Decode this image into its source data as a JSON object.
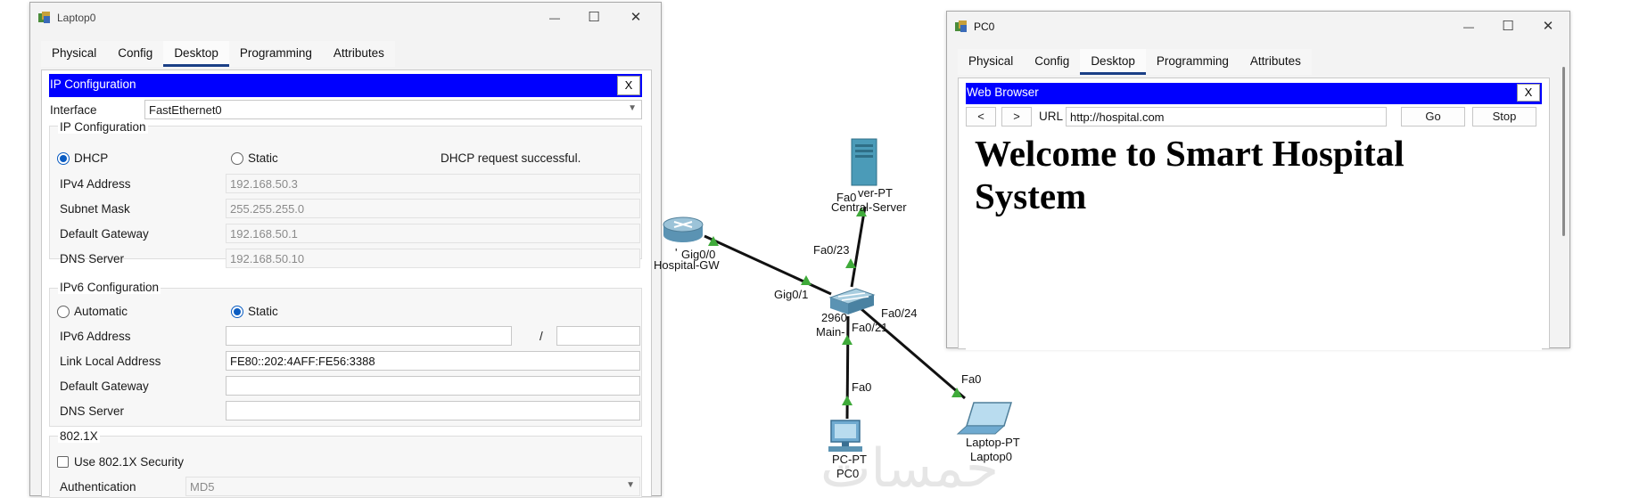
{
  "laptop_window": {
    "title": "Laptop0",
    "controls": {
      "minimize": "—",
      "maximize": "☐",
      "close": "✕"
    },
    "tabs": [
      "Physical",
      "Config",
      "Desktop",
      "Programming",
      "Attributes"
    ],
    "active_tab": "Desktop",
    "app_title": "IP Configuration",
    "close_label": "X",
    "interface_label": "Interface",
    "interface_value": "FastEthernet0",
    "ipv4": {
      "group_title": "IP Configuration",
      "dhcp_label": "DHCP",
      "static_label": "Static",
      "status": "DHCP request successful.",
      "ipv4_address_label": "IPv4 Address",
      "ipv4_address": "192.168.50.3",
      "subnet_mask_label": "Subnet Mask",
      "subnet_mask": "255.255.255.0",
      "gateway_label": "Default Gateway",
      "gateway": "192.168.50.1",
      "dns_label": "DNS Server",
      "dns": "192.168.50.10"
    },
    "ipv6": {
      "group_title": "IPv6 Configuration",
      "automatic_label": "Automatic",
      "static_label": "Static",
      "address_label": "IPv6 Address",
      "address": "",
      "slash": "/",
      "prefix": "",
      "link_local_label": "Link Local Address",
      "link_local": "FE80::202:4AFF:FE56:3388",
      "gateway_label": "Default Gateway",
      "gateway": "",
      "dns_label": "DNS Server",
      "dns": ""
    },
    "dot1x": {
      "group_title": "802.1X",
      "use_label": "Use 802.1X Security",
      "auth_label": "Authentication",
      "auth_value": "MD5"
    }
  },
  "pc_window": {
    "title": "PC0",
    "controls": {
      "minimize": "—",
      "maximize": "☐",
      "close": "✕"
    },
    "tabs": [
      "Physical",
      "Config",
      "Desktop",
      "Programming",
      "Attributes"
    ],
    "active_tab": "Desktop",
    "app_title": "Web Browser",
    "close_label": "X",
    "back_label": "<",
    "forward_label": ">",
    "url_label": "URL",
    "url_value": "http://hospital.com",
    "go_label": "Go",
    "stop_label": "Stop",
    "page_heading_line1": "Welcome to Smart Hospital",
    "page_heading_line2": "System"
  },
  "topology": {
    "labels": {
      "server_fa0": "Fa0",
      "server_name1": "ver-PT",
      "server_name2": "Central-Server",
      "switch_fa023": "Fa0/23",
      "router_gig00": "Gig0/0",
      "router_name": "Hospital-GW",
      "router_apostrophe": "'",
      "switch_gig01": "Gig0/1",
      "switch_model": "2960",
      "switch_name": "Main-",
      "switch_fa024": "Fa0/24",
      "switch_fa021": "Fa0/21",
      "pc_fa0": "Fa0",
      "pc_type": "PC-PT",
      "pc_name": "PC0",
      "laptop_fa0": "Fa0",
      "laptop_type": "Laptop-PT",
      "laptop_name": "Laptop0"
    },
    "link_color": "#111111",
    "link_up_color": "#3faa3a",
    "watermark": "خمسات"
  }
}
